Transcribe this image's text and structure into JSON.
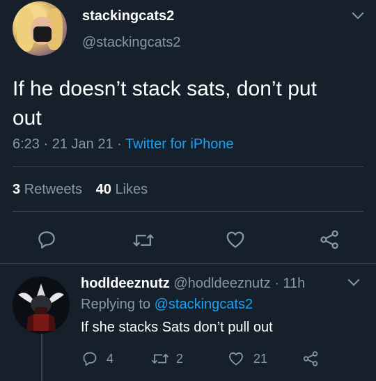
{
  "tweet": {
    "display_name": "stackingcats2",
    "handle": "@stackingcats2",
    "text_line1": "If he doesn’t stack sats, don’t put",
    "text_line2": "out",
    "time": "6:23",
    "date": "21 Jan 21",
    "source": "Twitter for iPhone",
    "retweets_count": "3",
    "retweets_label": "Retweets",
    "likes_count": "40",
    "likes_label": "Likes"
  },
  "reply": {
    "display_name": "hodldeeznutz",
    "handle": "@hodldeeznutz",
    "age": "11h",
    "replying_label": "Replying to",
    "replying_to": "@stackingcats2",
    "text": "If she stacks Sats don’t pull out",
    "reply_count": "4",
    "retweet_count": "2",
    "like_count": "21"
  },
  "separator": "·",
  "icons": {
    "reply": "reply-icon",
    "retweet": "retweet-icon",
    "like": "heart-icon",
    "share": "share-icon",
    "more": "chevron-down-icon"
  },
  "colors": {
    "background": "#15202b",
    "text": "#ffffff",
    "muted": "#8899a6",
    "link": "#1da1f2",
    "divider": "#38444d"
  }
}
